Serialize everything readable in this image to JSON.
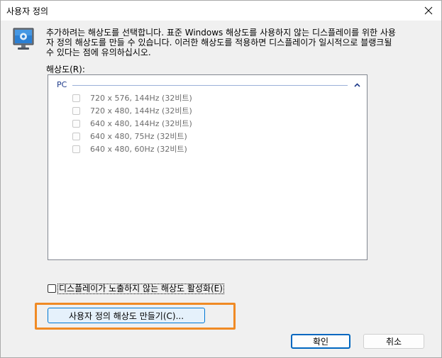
{
  "window": {
    "title": "사용자 정의",
    "close_icon": "close-icon"
  },
  "header": {
    "icon": "monitor-icon",
    "description_line1": "추가하려는 해상도를 선택합니다. 표준 Windows 해상도를 사용하지 않는 디스플레이를 위한 사용",
    "description_line2": "자 정의 해상도를 만들 수 있습니다. 이러한 해상도를 적용하면 디스플레이가 일시적으로 블랭크될",
    "description_line3": "수 있다는 점에 유의하십시오."
  },
  "resolution": {
    "label": "해상도(R):",
    "group_name": "PC",
    "group_chevron": "chevron-up-icon",
    "items": [
      {
        "label": "720 x 576, 144Hz (32비트)",
        "checked": false
      },
      {
        "label": "720 x 480, 144Hz (32비트)",
        "checked": false
      },
      {
        "label": "640 x 480, 144Hz (32비트)",
        "checked": false
      },
      {
        "label": "640 x 480, 75Hz (32비트)",
        "checked": false
      },
      {
        "label": "640 x 480, 60Hz (32비트)",
        "checked": false
      }
    ]
  },
  "enable_option": {
    "label": "디스플레이가 노출하지 않는 해상도 활성화(E)",
    "checked": false
  },
  "buttons": {
    "create_custom": "사용자 정의 해상도 만들기(C)...",
    "ok": "확인",
    "cancel": "취소"
  },
  "colors": {
    "highlight": "#f08a24",
    "accent": "#0078d4",
    "group_text": "#1e3a8a"
  }
}
